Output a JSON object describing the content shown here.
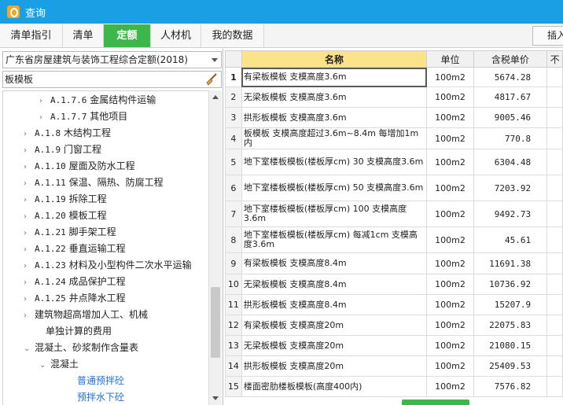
{
  "window": {
    "title": "查询"
  },
  "tabs": [
    {
      "label": "清单指引",
      "active": false
    },
    {
      "label": "清单",
      "active": false
    },
    {
      "label": "定额",
      "active": true
    },
    {
      "label": "人材机",
      "active": false
    },
    {
      "label": "我的数据",
      "active": false
    }
  ],
  "toolbar": {
    "insert_label": "插入"
  },
  "left": {
    "quota_selector": "广东省房屋建筑与装饰工程综合定额(2018)",
    "search_value": "板模板",
    "tree": [
      {
        "caret": "›",
        "code": "A.1.7.6",
        "label": "金属结构件运输"
      },
      {
        "caret": "›",
        "code": "A.1.7.7",
        "label": "其他项目"
      },
      {
        "caret": "›",
        "code": "A.1.8",
        "label": "木结构工程"
      },
      {
        "caret": "›",
        "code": "A.1.9",
        "label": "门窗工程"
      },
      {
        "caret": "›",
        "code": "A.1.10",
        "label": "屋面及防水工程"
      },
      {
        "caret": "›",
        "code": "A.1.11",
        "label": "保温、隔热、防腐工程"
      },
      {
        "caret": "›",
        "code": "A.1.19",
        "label": "拆除工程"
      },
      {
        "caret": "›",
        "code": "A.1.20",
        "label": "模板工程"
      },
      {
        "caret": "›",
        "code": "A.1.21",
        "label": "脚手架工程"
      },
      {
        "caret": "›",
        "code": "A.1.22",
        "label": "垂直运输工程"
      },
      {
        "caret": "›",
        "code": "A.1.23",
        "label": "材料及小型构件二次水平运输"
      },
      {
        "caret": "›",
        "code": "A.1.24",
        "label": "成品保护工程"
      },
      {
        "caret": "›",
        "code": "A.1.25",
        "label": "井点降水工程"
      },
      {
        "caret": "›",
        "code": "",
        "label": "建筑物超高增加人工、机械"
      },
      {
        "caret": "",
        "code": "",
        "label": "单独计算的费用"
      },
      {
        "caret": "⌄",
        "code": "",
        "label": "混凝土、砂浆制作含量表"
      },
      {
        "caret": "⌄",
        "code": "",
        "label": "混凝土"
      },
      {
        "caret": "",
        "code": "",
        "label": "普通预拌砼"
      },
      {
        "caret": "",
        "code": "",
        "label": "预拌水下砼"
      }
    ]
  },
  "grid": {
    "columns": [
      "名称",
      "单位",
      "含税单价",
      "不"
    ],
    "rows": [
      {
        "idx": "1",
        "name": "有梁板模板 支模高度3.6m",
        "unit": "100m2",
        "price": "5674.28"
      },
      {
        "idx": "2",
        "name": "无梁板模板 支模高度3.6m",
        "unit": "100m2",
        "price": "4817.67"
      },
      {
        "idx": "3",
        "name": "拱形板模板 支模高度3.6m",
        "unit": "100m2",
        "price": "9005.46"
      },
      {
        "idx": "4",
        "name": "板模板 支模高度超过3.6m~8.4m 每增加1m内",
        "unit": "100m2",
        "price": "770.8"
      },
      {
        "idx": "5",
        "name": "地下室楼板模板(楼板厚cm) 30 支模高度3.6m",
        "unit": "100m2",
        "price": "6304.48"
      },
      {
        "idx": "6",
        "name": "地下室楼板模板(楼板厚cm) 50 支模高度3.6m",
        "unit": "100m2",
        "price": "7203.92"
      },
      {
        "idx": "7",
        "name": "地下室楼板模板(楼板厚cm) 100 支模高度3.6m",
        "unit": "100m2",
        "price": "9492.73"
      },
      {
        "idx": "8",
        "name": "地下室楼板模板(楼板厚cm) 每减1cm 支模高度3.6m",
        "unit": "100m2",
        "price": "45.61"
      },
      {
        "idx": "9",
        "name": "有梁板模板 支模高度8.4m",
        "unit": "100m2",
        "price": "11691.38"
      },
      {
        "idx": "10",
        "name": "无梁板模板 支模高度8.4m",
        "unit": "100m2",
        "price": "10736.92"
      },
      {
        "idx": "11",
        "name": "拱形板模板 支模高度8.4m",
        "unit": "100m2",
        "price": "15207.9"
      },
      {
        "idx": "12",
        "name": "有梁板模板 支模高度20m",
        "unit": "100m2",
        "price": "22075.83"
      },
      {
        "idx": "13",
        "name": "无梁板模板 支模高度20m",
        "unit": "100m2",
        "price": "21080.15"
      },
      {
        "idx": "14",
        "name": "拱形板模板 支模高度20m",
        "unit": "100m2",
        "price": "25409.53"
      },
      {
        "idx": "15",
        "name": "楼面密肋楼板模板(高度400内)",
        "unit": "100m2",
        "price": "7576.82"
      }
    ]
  },
  "colors": {
    "titlebar": "#1a9fe5",
    "active_tab": "#3db74a",
    "header_highlight": "#fbe38a",
    "tree_link": "#1e6fd9"
  }
}
